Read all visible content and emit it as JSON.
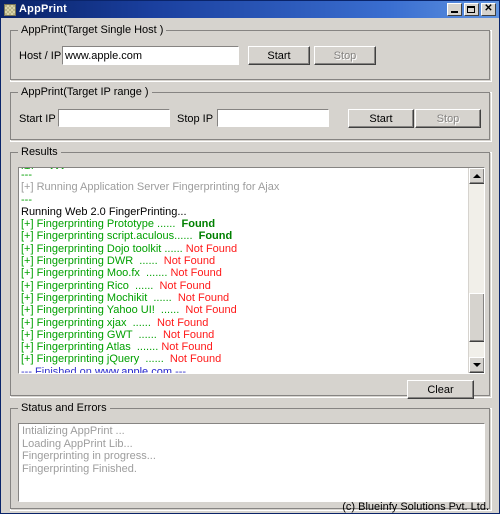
{
  "window": {
    "title": "AppPrint",
    "icon": "app-checker-icon",
    "buttons": {
      "minimize": "_",
      "maximize": "□",
      "close": "✕"
    }
  },
  "single_host": {
    "group_title": "AppPrint(Target Single Host )",
    "host_label": "Host / IP",
    "host_value": "www.apple.com",
    "host_placeholder": "",
    "start_label": "Start",
    "stop_label": "Stop",
    "stop_disabled": true
  },
  "ip_range": {
    "group_title": "AppPrint(Target IP range )",
    "start_ip_label": "Start IP",
    "start_ip_value": "",
    "stop_ip_label": "Stop IP",
    "stop_ip_value": "",
    "start_label": "Start",
    "stop_label": "Stop",
    "stop_disabled": true
  },
  "results": {
    "group_title": "Results",
    "clear_label": "Clear",
    "scrollbar": {
      "up_arrow": "▲",
      "down_arrow": "▼",
      "thumb_top_pct": 62,
      "thumb_height_pct": 28
    },
    "lines": [
      {
        "segments": [
          {
            "text": "[+] ... xxx ...   ...",
            "color": "green"
          }
        ],
        "clipped": true
      },
      {
        "segments": [
          {
            "text": "---",
            "color": "green"
          }
        ]
      },
      {
        "segments": [
          {
            "text": "[+] Running Application Server Fingerprinting for Ajax",
            "color": "gray"
          }
        ]
      },
      {
        "segments": [
          {
            "text": "---",
            "color": "green"
          }
        ]
      },
      {
        "segments": [
          {
            "text": "Running Web 2.0 FingerPrinting...",
            "color": "black"
          }
        ]
      },
      {
        "segments": [
          {
            "text": "[+] Fingerprinting Prototype ......  ",
            "color": "green"
          },
          {
            "text": "Found",
            "color": "green-bold"
          }
        ]
      },
      {
        "segments": [
          {
            "text": "[+] Fingerprinting script.aculous......  ",
            "color": "green"
          },
          {
            "text": "Found",
            "color": "green-bold"
          }
        ]
      },
      {
        "segments": [
          {
            "text": "[+] Fingerprinting Dojo toolkit ...... ",
            "color": "green"
          },
          {
            "text": "Not Found",
            "color": "red"
          }
        ]
      },
      {
        "segments": [
          {
            "text": "[+] Fingerprinting DWR  ......  ",
            "color": "green"
          },
          {
            "text": "Not Found",
            "color": "red"
          }
        ]
      },
      {
        "segments": [
          {
            "text": "[+] Fingerprinting Moo.fx  ....... ",
            "color": "green"
          },
          {
            "text": "Not Found",
            "color": "red"
          }
        ]
      },
      {
        "segments": [
          {
            "text": "[+] Fingerprinting Rico  ......  ",
            "color": "green"
          },
          {
            "text": "Not Found",
            "color": "red"
          }
        ]
      },
      {
        "segments": [
          {
            "text": "[+] Fingerprinting Mochikit  ......  ",
            "color": "green"
          },
          {
            "text": "Not Found",
            "color": "red"
          }
        ]
      },
      {
        "segments": [
          {
            "text": "[+] Fingerprinting Yahoo UI!  ......  ",
            "color": "green"
          },
          {
            "text": "Not Found",
            "color": "red"
          }
        ]
      },
      {
        "segments": [
          {
            "text": "[+] Fingerprinting xjax  ......  ",
            "color": "green"
          },
          {
            "text": "Not Found",
            "color": "red"
          }
        ]
      },
      {
        "segments": [
          {
            "text": "[+] Fingerprinting GWT  ......  ",
            "color": "green"
          },
          {
            "text": "Not Found",
            "color": "red"
          }
        ]
      },
      {
        "segments": [
          {
            "text": "[+] Fingerprinting Atlas  ....... ",
            "color": "green"
          },
          {
            "text": "Not Found",
            "color": "red"
          }
        ]
      },
      {
        "segments": [
          {
            "text": "[+] Fingerprinting jQuery  ......  ",
            "color": "green"
          },
          {
            "text": "Not Found",
            "color": "red"
          }
        ]
      },
      {
        "segments": [
          {
            "text": "--- Finished on ",
            "color": "blue"
          },
          {
            "text": "www.apple.com",
            "color": "link"
          },
          {
            "text": " ---",
            "color": "blue"
          }
        ]
      }
    ]
  },
  "status": {
    "group_title": "Status and Errors",
    "lines": [
      "Intializing AppPrint ...",
      "Loading AppPrint Lib...",
      "Fingerprinting in progress...",
      "Fingerprinting Finished."
    ]
  },
  "footer": {
    "copyright": "(c) Blueinfy Solutions Pvt. Ltd."
  },
  "colors": {
    "window_bg": "#d6d3ce",
    "title_bar": "#0a246a",
    "found": "#008000",
    "not_found": "#ff1a1a",
    "link": "#2222cc",
    "disabled_text": "#9d9d9d"
  }
}
